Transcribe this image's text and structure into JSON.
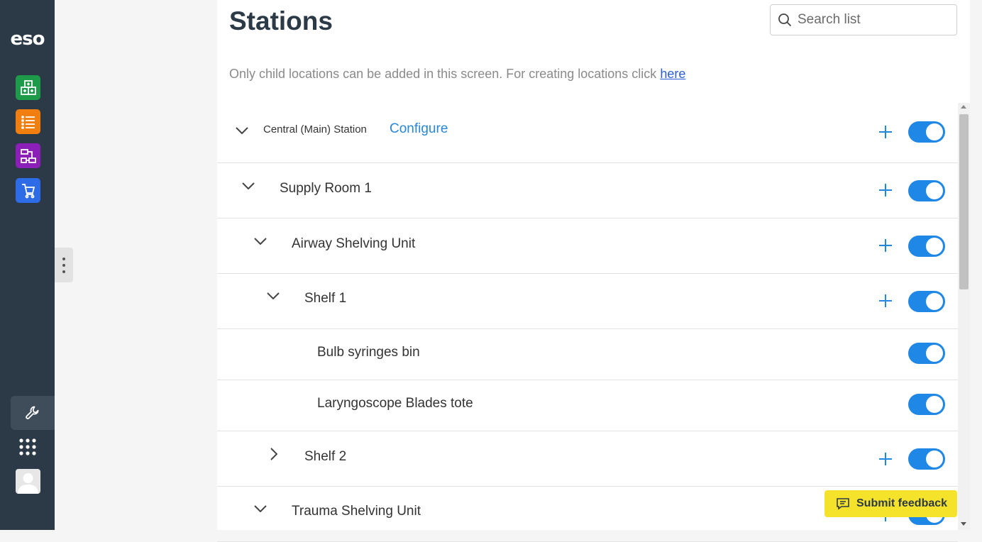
{
  "brand": {
    "logo_text": "eso"
  },
  "rail": {
    "apps": [
      {
        "name": "inventory-app-icon",
        "color": "#1e9b4a"
      },
      {
        "name": "list-app-icon",
        "color": "#f07f0f"
      },
      {
        "name": "workflow-app-icon",
        "color": "#8b1fb8"
      },
      {
        "name": "cart-app-icon",
        "color": "#2e6be6"
      }
    ]
  },
  "page": {
    "title": "Stations",
    "search_placeholder": "Search list",
    "note_text": "Only child locations can be added in this screen. For creating locations click ",
    "note_link": "here"
  },
  "tree": {
    "root": {
      "label": "Central (Main) Station",
      "configure_label": "Configure",
      "enabled": true
    },
    "rows": [
      {
        "label": "Supply Room 1",
        "expanded": true,
        "enabled": true
      },
      {
        "label": "Airway Shelving Unit",
        "expanded": true,
        "enabled": true
      },
      {
        "label": "Shelf 1",
        "expanded": true,
        "enabled": true
      },
      {
        "label": "Bulb syringes bin",
        "enabled": true
      },
      {
        "label": "Laryngoscope Blades tote",
        "enabled": true
      },
      {
        "label": "Shelf 2",
        "expanded": false,
        "enabled": true
      },
      {
        "label": "Trauma Shelving Unit",
        "expanded": true,
        "enabled": true
      }
    ]
  },
  "feedback": {
    "label": "Submit feedback"
  }
}
